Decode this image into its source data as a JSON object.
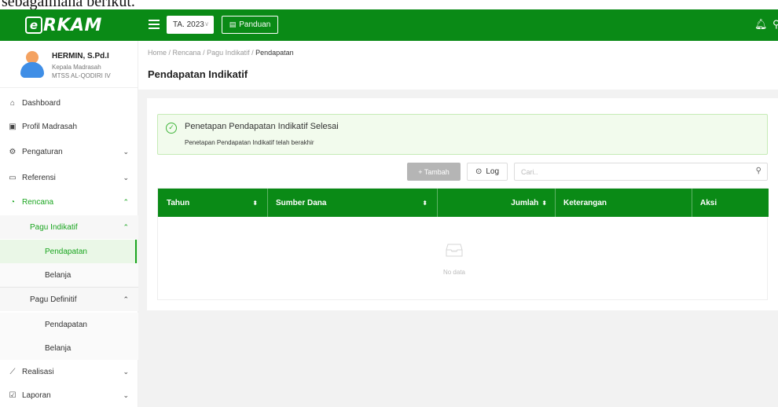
{
  "caption_fragment": "sebagaimana berikut.",
  "topbar": {
    "logo_letter": "e",
    "logo_text": "RKAM",
    "year_select": "TA. 2023",
    "guide_label": "Panduan"
  },
  "profile": {
    "name": "HERMIN, S.Pd.I",
    "role": "Kepala Madrasah",
    "school": "MTSS AL-QODIRI IV"
  },
  "sidebar": {
    "items": [
      {
        "label": "Dashboard",
        "icon": "home-icon"
      },
      {
        "label": "Profil Madrasah",
        "icon": "id-card-icon"
      },
      {
        "label": "Pengaturan",
        "icon": "gear-icon"
      },
      {
        "label": "Referensi",
        "icon": "folder-icon"
      },
      {
        "label": "Rencana",
        "icon": "clock-icon"
      },
      {
        "label": "Pagu Indikatif"
      },
      {
        "label": "Pendapatan"
      },
      {
        "label": "Belanja"
      },
      {
        "label": "Pagu Definitif"
      },
      {
        "label": "Pendapatan"
      },
      {
        "label": "Belanja"
      },
      {
        "label": "Realisasi",
        "icon": "trend-icon"
      },
      {
        "label": "Laporan",
        "icon": "report-icon"
      }
    ]
  },
  "breadcrumb": {
    "items": [
      "Home",
      "Rencana",
      "Pagu Indikatif",
      "Pendapatan"
    ]
  },
  "page_title": "Pendapatan Indikatif",
  "alert": {
    "title": "Penetapan Pendapatan Indikatif Selesai",
    "message": "Penetapan Pendapatan Indikatif telah berakhir"
  },
  "toolbar": {
    "add_label": "+ Tambah",
    "log_label": "Log",
    "search_placeholder": "Cari.."
  },
  "table": {
    "columns": [
      "Tahun",
      "Sumber Dana",
      "Jumlah",
      "Keterangan",
      "Aksi"
    ],
    "empty_text": "No data"
  },
  "colors": {
    "brand_green": "#0a8a16",
    "active_green": "#1aa51f"
  }
}
